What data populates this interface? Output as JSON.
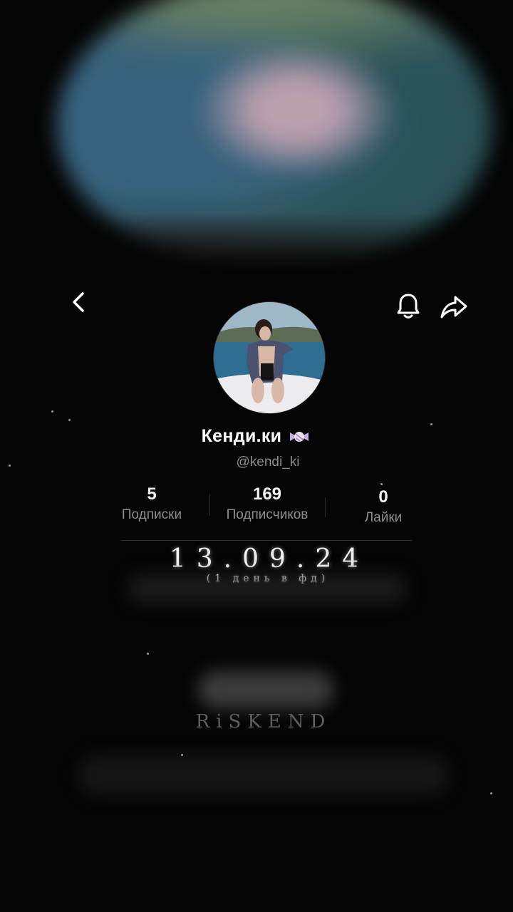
{
  "profile": {
    "display_name": "Кенди.ки",
    "handle": "@kendi_ki",
    "emoji_icon": "candy-icon"
  },
  "stats": [
    {
      "value": "5",
      "label": "Подписки"
    },
    {
      "value": "169",
      "label": "Подписчиков"
    },
    {
      "value": "0",
      "label": "Лайки"
    }
  ],
  "overlay": {
    "date": "13.09.24",
    "caption": "(1 день в фд)",
    "watermark": "RiSKEND"
  },
  "icons": {
    "back": "chevron-left-icon",
    "bell": "bell-icon",
    "share": "share-arrow-icon"
  },
  "colors": {
    "background": "#050505",
    "text_primary": "#ffffff",
    "text_secondary": "#8a8a8a"
  }
}
